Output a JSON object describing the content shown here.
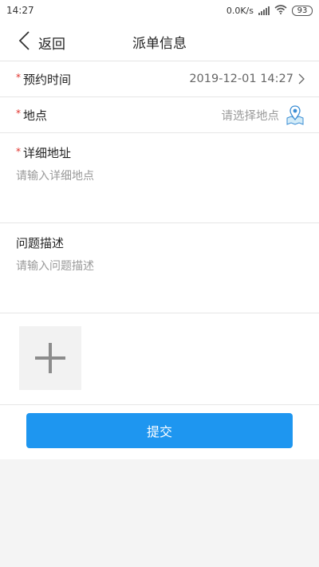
{
  "status_bar": {
    "time": "14:27",
    "network_speed": "0.0K/s",
    "battery": "93"
  },
  "header": {
    "back_label": "返回",
    "title": "派单信息"
  },
  "form": {
    "appointment_time": {
      "required_mark": "*",
      "label": "预约时间",
      "value": "2019-12-01 14:27"
    },
    "location": {
      "required_mark": "*",
      "label": "地点",
      "placeholder": "请选择地点",
      "icon": "location-pin-icon"
    },
    "detail_address": {
      "required_mark": "*",
      "label": "详细地址",
      "placeholder": "请输入详细地点"
    },
    "problem_description": {
      "label": "问题描述",
      "placeholder": "请输入问题描述"
    },
    "upload": {
      "icon": "plus-icon"
    }
  },
  "submit_label": "提交",
  "colors": {
    "accent": "#1e96f0",
    "required": "#e0302a"
  }
}
